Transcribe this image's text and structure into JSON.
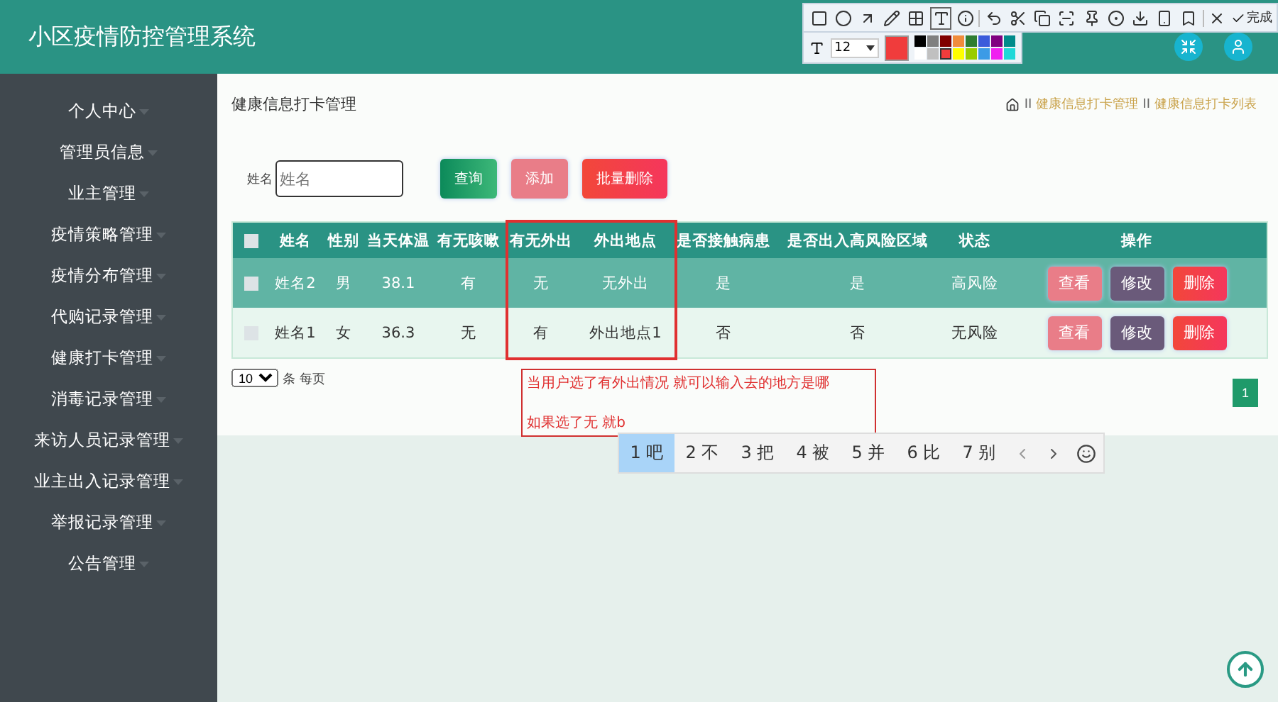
{
  "header": {
    "title": "小区疫情防控管理系统"
  },
  "sidebar": {
    "items": [
      {
        "label": "个人中心"
      },
      {
        "label": "管理员信息"
      },
      {
        "label": "业主管理"
      },
      {
        "label": "疫情策略管理"
      },
      {
        "label": "疫情分布管理"
      },
      {
        "label": "代购记录管理"
      },
      {
        "label": "健康打卡管理"
      },
      {
        "label": "消毒记录管理"
      },
      {
        "label": "来访人员记录管理"
      },
      {
        "label": "业主出入记录管理"
      },
      {
        "label": "举报记录管理"
      },
      {
        "label": "公告管理"
      }
    ]
  },
  "page": {
    "title": "健康信息打卡管理",
    "breadcrumb": [
      {
        "separator": "II",
        "label": "健康信息打卡管理"
      },
      {
        "separator": "II",
        "label": "健康信息打卡列表"
      }
    ]
  },
  "search": {
    "label": "姓名",
    "placeholder": "姓名",
    "buttons": [
      {
        "label": "查询",
        "kind": "query"
      },
      {
        "label": "添加",
        "kind": "add"
      },
      {
        "label": "批量删除",
        "kind": "delete"
      }
    ]
  },
  "table": {
    "all_checked": false,
    "columns": [
      "姓名",
      "性别",
      "当天体温",
      "有无咳嗽",
      "有无外出",
      "外出地点",
      "是否接触病患",
      "是否出入高风险区域",
      "状态",
      "操作"
    ],
    "rows": [
      {
        "checked": false,
        "highlighted": true,
        "cells": [
          "姓名2",
          "男",
          "38.1",
          "有",
          "无",
          "无外出",
          "是",
          "是",
          "高风险"
        ],
        "actions": [
          {
            "label": "查看",
            "kind": "view"
          },
          {
            "label": "修改",
            "kind": "edit"
          },
          {
            "label": "删除",
            "kind": "delete"
          }
        ]
      },
      {
        "checked": false,
        "highlighted": false,
        "cells": [
          "姓名1",
          "女",
          "36.3",
          "无",
          "有",
          "外出地点1",
          "否",
          "否",
          "无风险"
        ],
        "actions": [
          {
            "label": "查看",
            "kind": "view"
          },
          {
            "label": "修改",
            "kind": "edit"
          },
          {
            "label": "删除",
            "kind": "delete"
          }
        ]
      }
    ]
  },
  "pagination": {
    "page_size": "10",
    "page_size_label": "条 每页",
    "pages": [
      {
        "label": "1",
        "selected": true
      }
    ]
  },
  "annotation": {
    "lines": [
      "当用户选了有外出情况 就可以输入去的地方是哪",
      "如果选了无 就b"
    ]
  },
  "ime": {
    "candidates": [
      {
        "label": "1 吧",
        "selected": true
      },
      {
        "label": "2 不",
        "selected": false
      },
      {
        "label": "3 把",
        "selected": false
      },
      {
        "label": "4 被",
        "selected": false
      },
      {
        "label": "5 并",
        "selected": false
      },
      {
        "label": "6 比",
        "selected": false
      },
      {
        "label": "7 别",
        "selected": false
      }
    ]
  },
  "annotation_toolbar": {
    "draw_tools": [
      {
        "kind": "rect",
        "selected": false
      },
      {
        "kind": "ellipse",
        "selected": false
      },
      {
        "kind": "arrow",
        "selected": false
      },
      {
        "kind": "pen",
        "selected": false
      },
      {
        "kind": "mosaic",
        "selected": false
      },
      {
        "kind": "text",
        "selected": true
      },
      {
        "kind": "number",
        "selected": false
      }
    ],
    "edit_tools": [
      {
        "kind": "undo"
      },
      {
        "kind": "cut"
      },
      {
        "kind": "copy"
      },
      {
        "kind": "scan"
      },
      {
        "kind": "pin"
      },
      {
        "kind": "record"
      },
      {
        "kind": "download"
      },
      {
        "kind": "phone"
      },
      {
        "kind": "bookmark"
      }
    ],
    "done_label": "完成",
    "font_size": "12",
    "palette": [
      {
        "color": "#000000",
        "selected": false
      },
      {
        "color": "#808080",
        "selected": false
      },
      {
        "color": "#800000",
        "selected": false
      },
      {
        "color": "#f08c3c",
        "selected": false
      },
      {
        "color": "#2e7d32",
        "selected": false
      },
      {
        "color": "#3b5bdb",
        "selected": false
      },
      {
        "color": "#800080",
        "selected": false
      },
      {
        "color": "#008b8b",
        "selected": false
      },
      {
        "color": "#ffffff",
        "selected": false
      },
      {
        "color": "#c0c0c0",
        "selected": false
      },
      {
        "color": "#f03c3c",
        "selected": true
      },
      {
        "color": "#ffff00",
        "selected": false
      },
      {
        "color": "#99cc00",
        "selected": false
      },
      {
        "color": "#3c9be6",
        "selected": false
      },
      {
        "color": "#f020f0",
        "selected": false
      },
      {
        "color": "#20d8d8",
        "selected": false
      }
    ]
  }
}
